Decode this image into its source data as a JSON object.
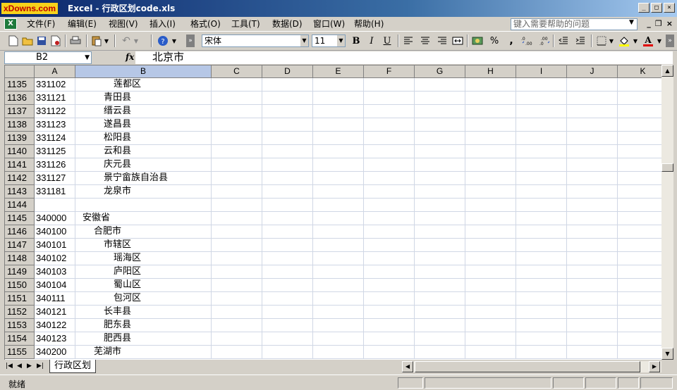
{
  "window": {
    "logo": "xDowns.com",
    "title": "Excel - 行政区划code.xls"
  },
  "menu": {
    "items": [
      "文件(F)",
      "编辑(E)",
      "视图(V)",
      "插入(I)",
      "格式(O)",
      "工具(T)",
      "数据(D)",
      "窗口(W)",
      "帮助(H)"
    ],
    "help_placeholder": "键入需要帮助的问题"
  },
  "toolbar": {
    "font_name": "宋体",
    "font_size": "11",
    "bold": "B",
    "italic": "I",
    "underline": "U",
    "percent": "%",
    "comma": ","
  },
  "formula_bar": {
    "name_box": "B2",
    "fx": "fx",
    "content": "北京市"
  },
  "grid": {
    "columns": [
      "A",
      "B",
      "C",
      "D",
      "E",
      "F",
      "G",
      "H",
      "I",
      "J",
      "K"
    ],
    "selected_column": "B",
    "rows": [
      {
        "num": "1135",
        "code": "331102",
        "name": "莲都区",
        "level": 3
      },
      {
        "num": "1136",
        "code": "331121",
        "name": "青田县",
        "level": 2
      },
      {
        "num": "1137",
        "code": "331122",
        "name": "缙云县",
        "level": 2
      },
      {
        "num": "1138",
        "code": "331123",
        "name": "遂昌县",
        "level": 2
      },
      {
        "num": "1139",
        "code": "331124",
        "name": "松阳县",
        "level": 2
      },
      {
        "num": "1140",
        "code": "331125",
        "name": "云和县",
        "level": 2
      },
      {
        "num": "1141",
        "code": "331126",
        "name": "庆元县",
        "level": 2
      },
      {
        "num": "1142",
        "code": "331127",
        "name": "景宁畲族自治县",
        "level": 2
      },
      {
        "num": "1143",
        "code": "331181",
        "name": "龙泉市",
        "level": 2
      },
      {
        "num": "1144",
        "code": "",
        "name": "",
        "level": 0
      },
      {
        "num": "1145",
        "code": "340000",
        "name": "安徽省",
        "level": 0
      },
      {
        "num": "1146",
        "code": "340100",
        "name": "合肥市",
        "level": 1
      },
      {
        "num": "1147",
        "code": "340101",
        "name": "市辖区",
        "level": 2
      },
      {
        "num": "1148",
        "code": "340102",
        "name": "瑶海区",
        "level": 3
      },
      {
        "num": "1149",
        "code": "340103",
        "name": "庐阳区",
        "level": 3
      },
      {
        "num": "1150",
        "code": "340104",
        "name": "蜀山区",
        "level": 3
      },
      {
        "num": "1151",
        "code": "340111",
        "name": "包河区",
        "level": 3
      },
      {
        "num": "1152",
        "code": "340121",
        "name": "长丰县",
        "level": 2
      },
      {
        "num": "1153",
        "code": "340122",
        "name": "肥东县",
        "level": 2
      },
      {
        "num": "1154",
        "code": "340123",
        "name": "肥西县",
        "level": 2
      },
      {
        "num": "1155",
        "code": "340200",
        "name": "芜湖市",
        "level": 1
      }
    ]
  },
  "sheet_tabs": {
    "active": "行政区划"
  },
  "status": {
    "text": "就绪"
  }
}
